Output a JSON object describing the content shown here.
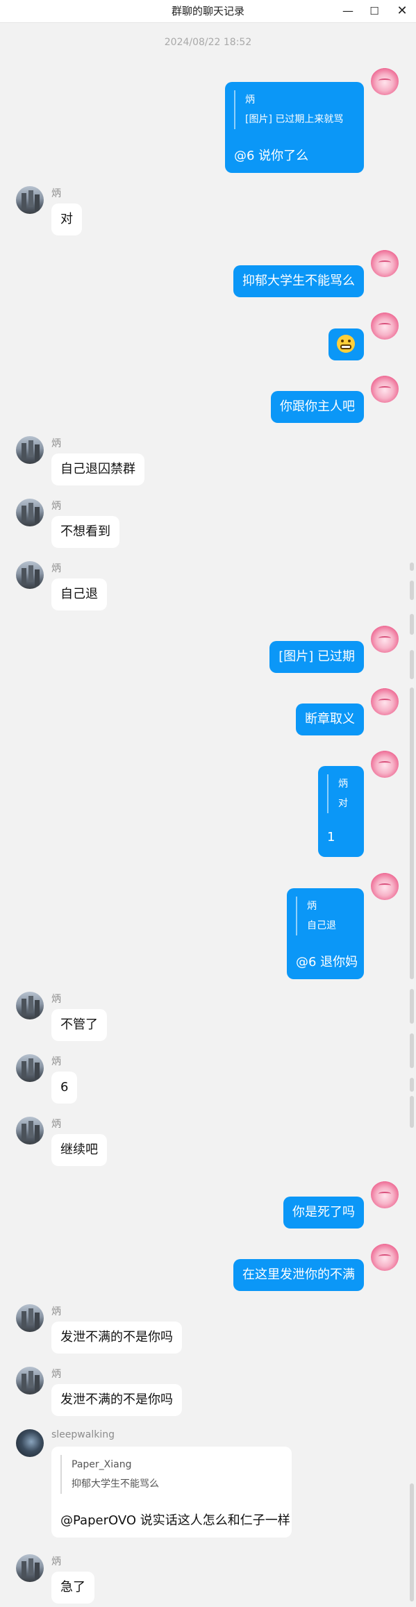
{
  "window": {
    "title": "群聊的聊天记录",
    "controls": {
      "minimize": "—",
      "maximize": "☐",
      "close": "✕"
    }
  },
  "timestamp": "2024/08/22 18:52",
  "messages": [
    {
      "side": "out",
      "quote_sender": "炳",
      "quote_text": "[图片] 已过期上来就骂",
      "text": "@6 说你了么"
    },
    {
      "side": "in",
      "sender": "炳",
      "text": "对"
    },
    {
      "side": "out",
      "text": "抑郁大学生不能骂么"
    },
    {
      "side": "out",
      "emoji": "grinning-face"
    },
    {
      "side": "out",
      "text": "你跟你主人吧"
    },
    {
      "side": "in",
      "sender": "炳",
      "text": "自己退囚禁群"
    },
    {
      "side": "in",
      "sender": "炳",
      "text": "不想看到"
    },
    {
      "side": "in",
      "sender": "炳",
      "text": "自己退"
    },
    {
      "side": "out",
      "text": "[图片] 已过期"
    },
    {
      "side": "out",
      "text": "断章取义"
    },
    {
      "side": "out",
      "quote_sender": "炳",
      "quote_text": "对",
      "text": "1"
    },
    {
      "side": "out",
      "quote_sender": "炳",
      "quote_text": "自己退",
      "text": "@6 退你妈"
    },
    {
      "side": "in",
      "sender": "炳",
      "text": "不管了"
    },
    {
      "side": "in",
      "sender": "炳",
      "text": "6"
    },
    {
      "side": "in",
      "sender": "炳",
      "text": "继续吧"
    },
    {
      "side": "out",
      "text": "你是死了吗"
    },
    {
      "side": "out",
      "text": "在这里发泄你的不满"
    },
    {
      "side": "in",
      "sender": "炳",
      "text": "发泄不满的不是你吗"
    },
    {
      "side": "in",
      "sender": "炳",
      "text": "发泄不满的不是你吗"
    },
    {
      "side": "in",
      "sender": "sleepwalking",
      "quote_sender": "Paper_Xiang",
      "quote_text": "抑郁大学生不能骂么",
      "text": "@PaperOVO 说实话这人怎么和仁子一样"
    },
    {
      "side": "in",
      "sender": "炳",
      "text": "急了"
    }
  ]
}
